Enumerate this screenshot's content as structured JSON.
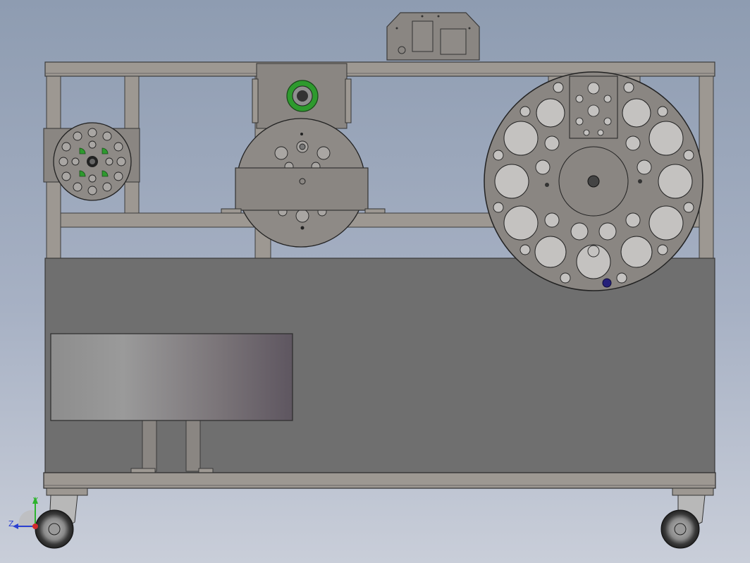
{
  "viewport": {
    "background_top": "#8e9cb1",
    "background_bottom": "#c9ced9"
  },
  "model": {
    "frame_color": "#9d9892",
    "panel_color": "#6f6f6f",
    "plate_color": "#8a8682",
    "green_hub_color": "#2e9a2e",
    "blue_knob_color": "#25207a"
  },
  "triad": {
    "y_label": "Y",
    "z_label": "Z",
    "y_color": "#2db32d",
    "z_color": "#2a3fd1",
    "x_color": "#d12a2a"
  }
}
